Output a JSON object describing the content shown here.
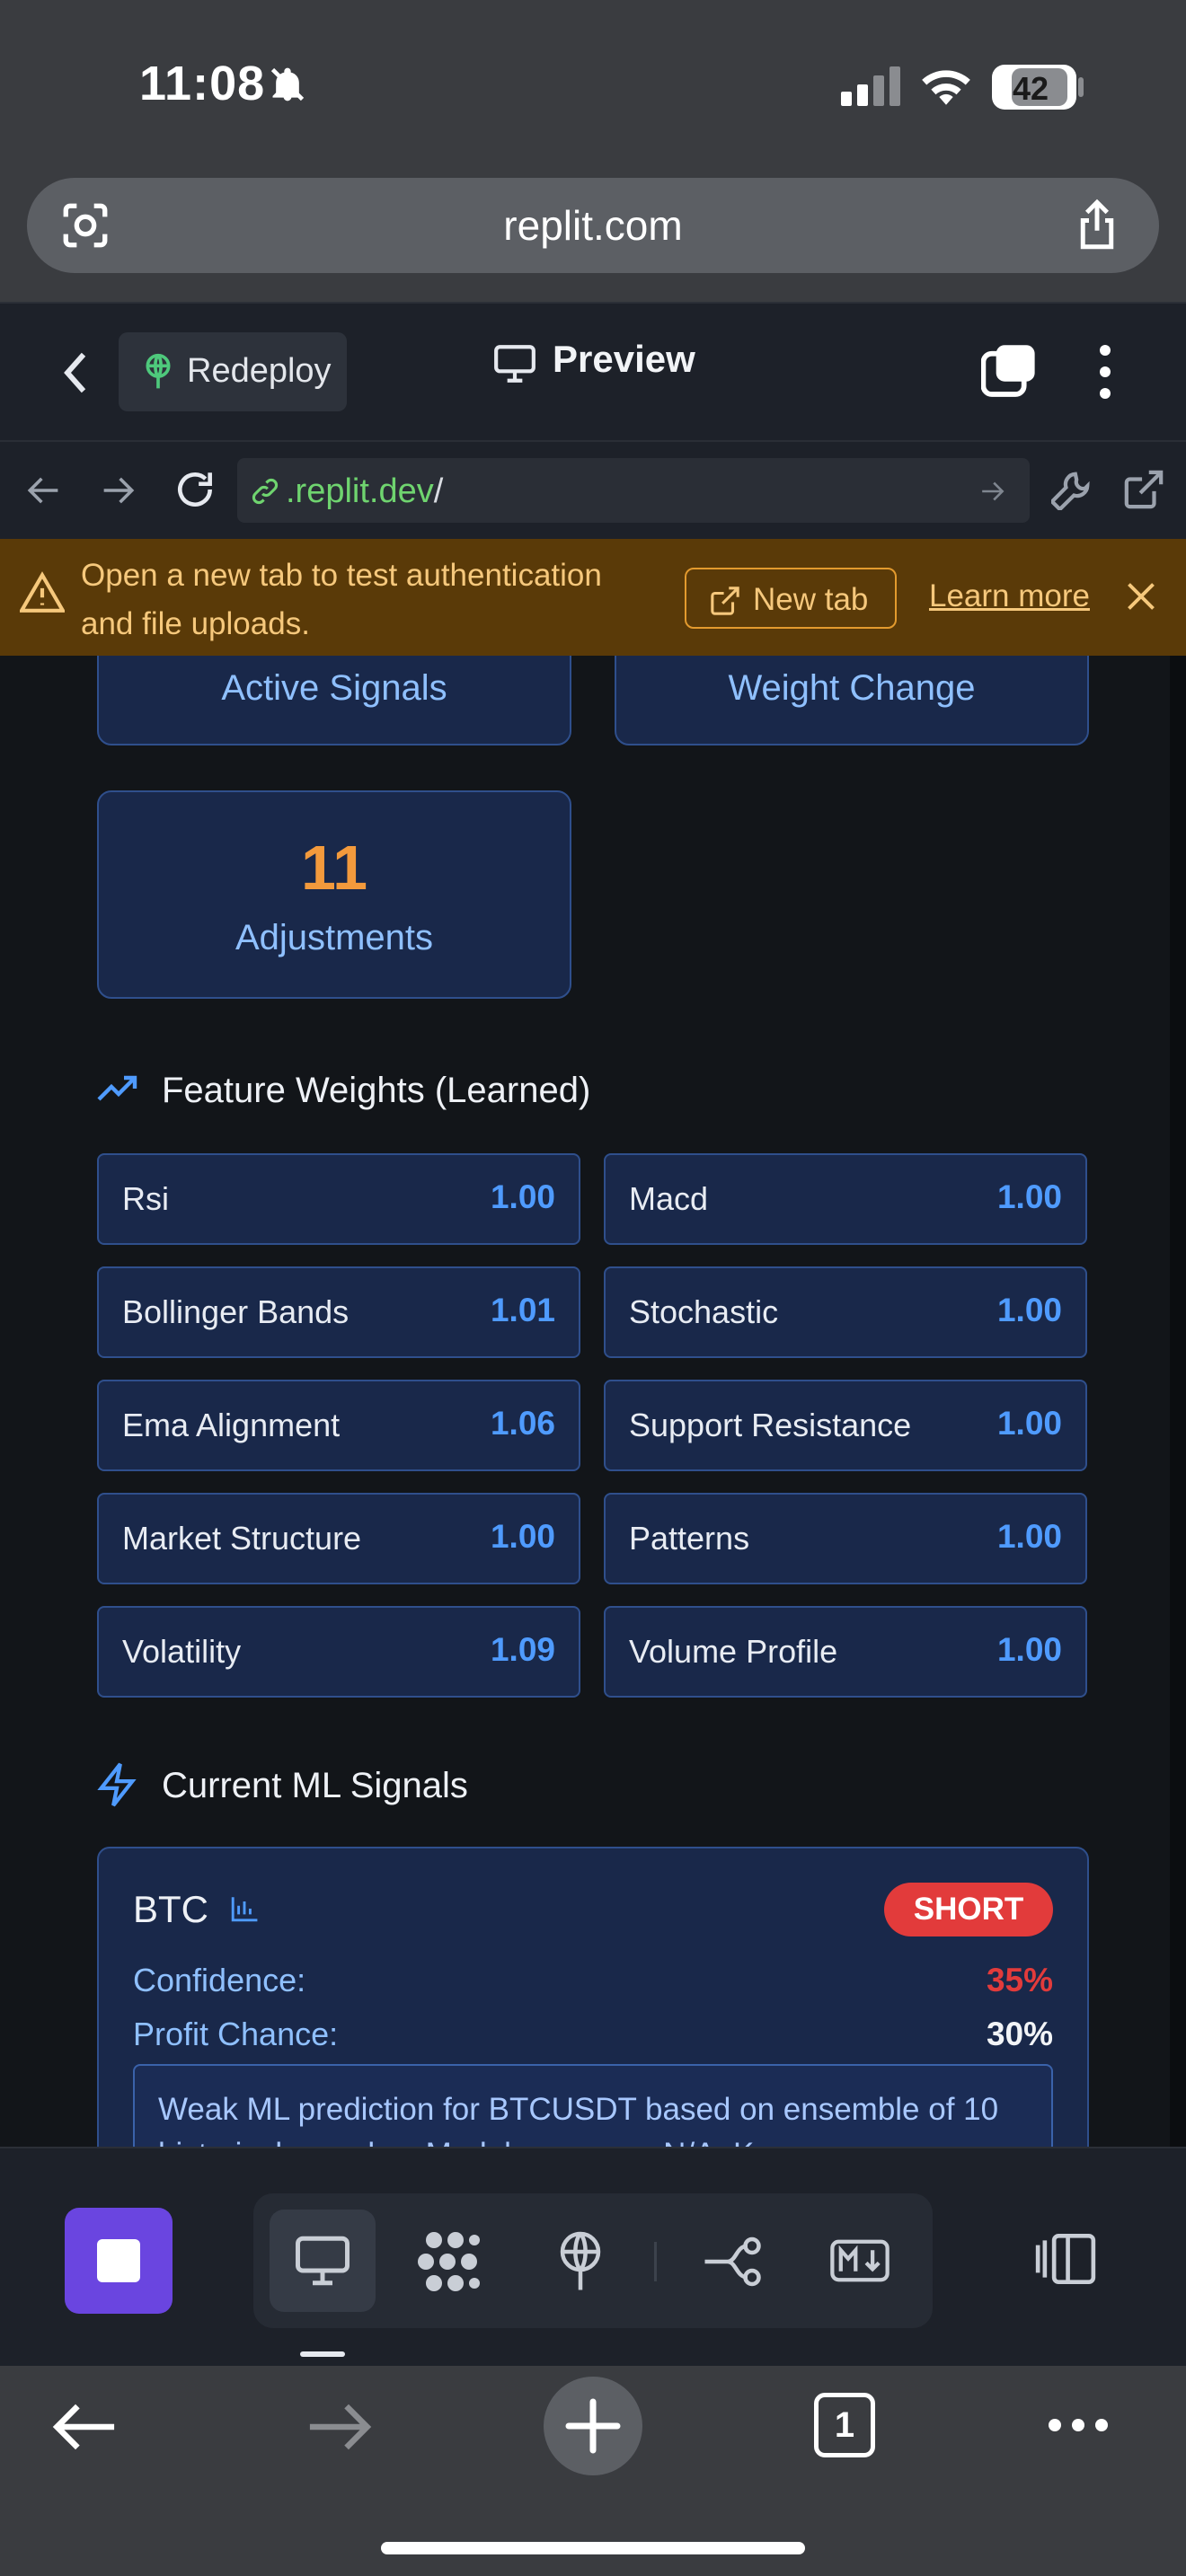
{
  "status_bar": {
    "time": "11:08",
    "battery": "42"
  },
  "safari": {
    "url": "replit.com",
    "tab_count": "1"
  },
  "replit_header": {
    "redeploy_label": "Redeploy",
    "preview_title": "Preview"
  },
  "browser": {
    "address": ".replit.dev",
    "address_suffix": "/"
  },
  "banner": {
    "message": "Open a new tab to test authentication and file uploads.",
    "new_tab_label": "New tab",
    "learn_more_label": "Learn more"
  },
  "stats": {
    "active_signals_label": "Active Signals",
    "weight_change_label": "Weight Change",
    "adjustments_value": "11",
    "adjustments_label": "Adjustments"
  },
  "feature_weights": {
    "title": "Feature Weights (Learned)",
    "items": [
      {
        "name": "Rsi",
        "value": "1.00"
      },
      {
        "name": "Macd",
        "value": "1.00"
      },
      {
        "name": "Bollinger Bands",
        "value": "1.01"
      },
      {
        "name": "Stochastic",
        "value": "1.00"
      },
      {
        "name": "Ema Alignment",
        "value": "1.06"
      },
      {
        "name": "Support Resistance",
        "value": "1.00"
      },
      {
        "name": "Market Structure",
        "value": "1.00"
      },
      {
        "name": "Patterns",
        "value": "1.00"
      },
      {
        "name": "Volatility",
        "value": "1.09"
      },
      {
        "name": "Volume Profile",
        "value": "1.00"
      }
    ]
  },
  "ml_signals": {
    "title": "Current ML Signals",
    "signal": {
      "symbol": "BTC",
      "direction": "SHORT",
      "confidence_label": "Confidence:",
      "confidence_value": "35%",
      "profit_label": "Profit Chance:",
      "profit_value": "30%",
      "reason": "Weak ML prediction for BTCUSDT based on ensemble of 10 historical samples. Model accuracy: N/A. Key"
    }
  },
  "colors": {
    "accent_blue": "#4f9bff",
    "adjustments_orange": "#f39a3c",
    "short_red": "#e23b3b",
    "banner_bg": "#5a3a08",
    "stop_purple": "#6a45e0"
  }
}
